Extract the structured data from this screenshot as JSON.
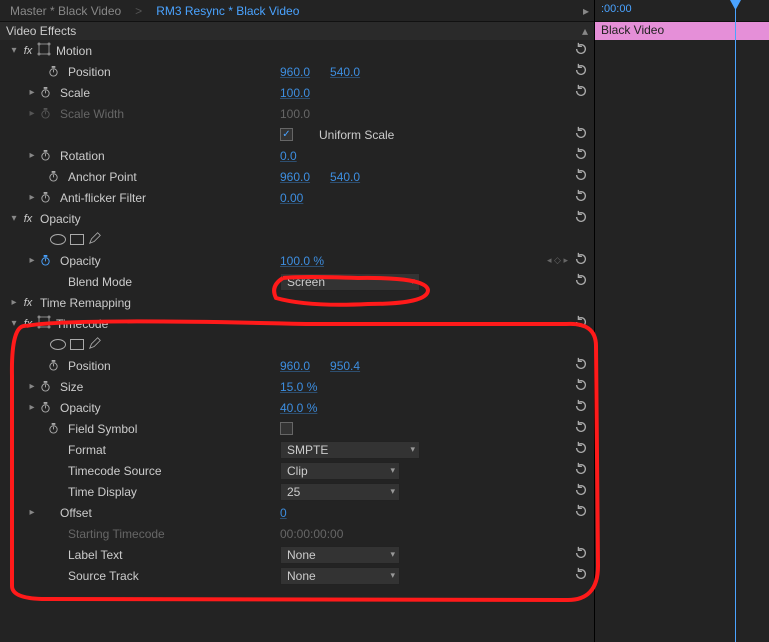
{
  "tabs": {
    "master": "Master * Black Video",
    "clip": "RM3 Resync * Black Video"
  },
  "section": "Video Effects",
  "timeline": {
    "time": ":00:00",
    "clip_label": "Black Video"
  },
  "motion": {
    "title": "Motion",
    "position": {
      "label": "Position",
      "x": "960.0",
      "y": "540.0"
    },
    "scale": {
      "label": "Scale",
      "v": "100.0"
    },
    "scale_width": {
      "label": "Scale Width",
      "v": "100.0"
    },
    "uniform": "Uniform Scale",
    "rotation": {
      "label": "Rotation",
      "v": "0.0"
    },
    "anchor": {
      "label": "Anchor Point",
      "x": "960.0",
      "y": "540.0"
    },
    "antiflicker": {
      "label": "Anti-flicker Filter",
      "v": "0.00"
    }
  },
  "opacity": {
    "title": "Opacity",
    "opacity": {
      "label": "Opacity",
      "v": "100.0 %"
    },
    "blend": {
      "label": "Blend Mode",
      "v": "Screen"
    }
  },
  "timeremap": {
    "title": "Time Remapping"
  },
  "timecode": {
    "title": "Timecode",
    "position": {
      "label": "Position",
      "x": "960.0",
      "y": "950.4"
    },
    "size": {
      "label": "Size",
      "v": "15.0 %"
    },
    "opacity": {
      "label": "Opacity",
      "v": "40.0 %"
    },
    "field": {
      "label": "Field Symbol"
    },
    "format": {
      "label": "Format",
      "v": "SMPTE"
    },
    "source": {
      "label": "Timecode Source",
      "v": "Clip"
    },
    "display": {
      "label": "Time Display",
      "v": "25"
    },
    "offset": {
      "label": "Offset",
      "v": "0"
    },
    "starting": {
      "label": "Starting Timecode",
      "v": "00:00:00:00"
    },
    "labeltext": {
      "label": "Label Text",
      "v": "None"
    },
    "track": {
      "label": "Source Track",
      "v": "None"
    }
  }
}
